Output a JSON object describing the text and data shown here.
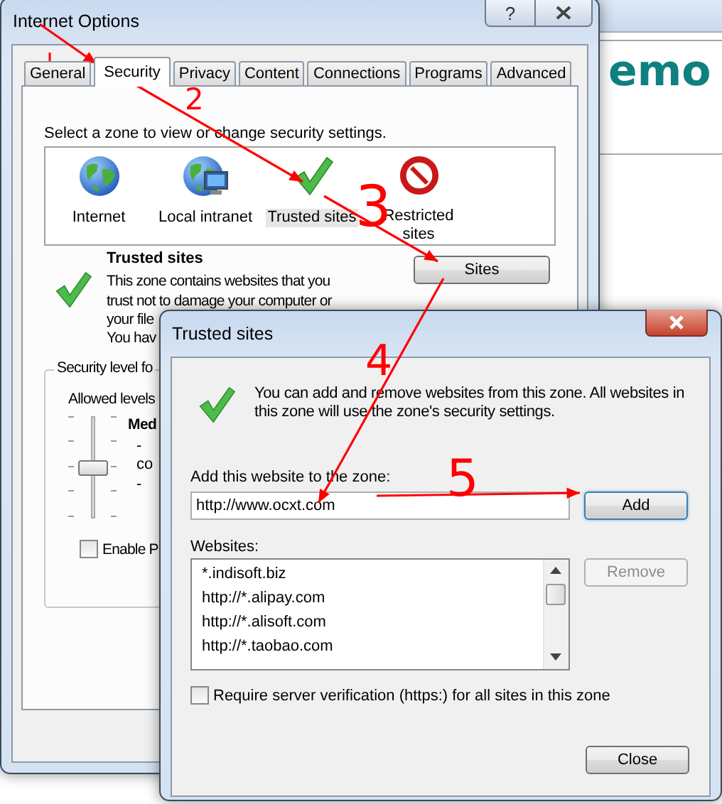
{
  "internet_options": {
    "title": "Internet Options",
    "help_button": "?",
    "tabs": [
      {
        "label": "General",
        "selected": false
      },
      {
        "label": "Security",
        "selected": true
      },
      {
        "label": "Privacy",
        "selected": false
      },
      {
        "label": "Content",
        "selected": false
      },
      {
        "label": "Connections",
        "selected": false
      },
      {
        "label": "Programs",
        "selected": false
      },
      {
        "label": "Advanced",
        "selected": false
      }
    ],
    "zone_prompt": "Select a zone to view or change security settings.",
    "zones": [
      {
        "kind": "internet",
        "label": "Internet",
        "selected": false
      },
      {
        "kind": "intranet",
        "label": "Local intranet",
        "selected": false
      },
      {
        "kind": "trusted",
        "label": "Trusted sites",
        "selected": true
      },
      {
        "kind": "restricted",
        "label": "Restricted sites",
        "selected": false
      }
    ],
    "zone_heading": "Trusted sites",
    "zone_description": [
      "This zone contains websites that you",
      "trust not to damage your computer or",
      "your file",
      "You hav"
    ],
    "sites_button": "Sites",
    "security_level": {
      "legend": "Security level fo",
      "allowed_levels": "Allowed levels",
      "level": 0.5,
      "level_name": "Med",
      "notes": [
        "-",
        "co",
        "-"
      ]
    },
    "enable_protected": {
      "label": "Enable P",
      "checked": false
    }
  },
  "trusted_sites": {
    "title": "Trusted sites",
    "info": "You can add and remove websites from this zone. All websites in this zone will use the zone's security settings.",
    "add_label": "Add this website to the zone:",
    "add_value": "http://www.ocxt.com",
    "add_button": "Add",
    "websites_label": "Websites:",
    "websites": [
      "*.indisoft.biz",
      "http://*.alipay.com",
      "http://*.alisoft.com",
      "http://*.taobao.com"
    ],
    "remove_button": {
      "label": "Remove",
      "disabled": true
    },
    "require_https": {
      "label": "Require server verification (https:) for all sites in this zone",
      "checked": false
    },
    "close_button": "Close"
  },
  "background_page": {
    "heading": "emo"
  },
  "annotations": [
    {
      "label": "2"
    },
    {
      "label": "3"
    },
    {
      "label": "4"
    },
    {
      "label": "5"
    }
  ]
}
